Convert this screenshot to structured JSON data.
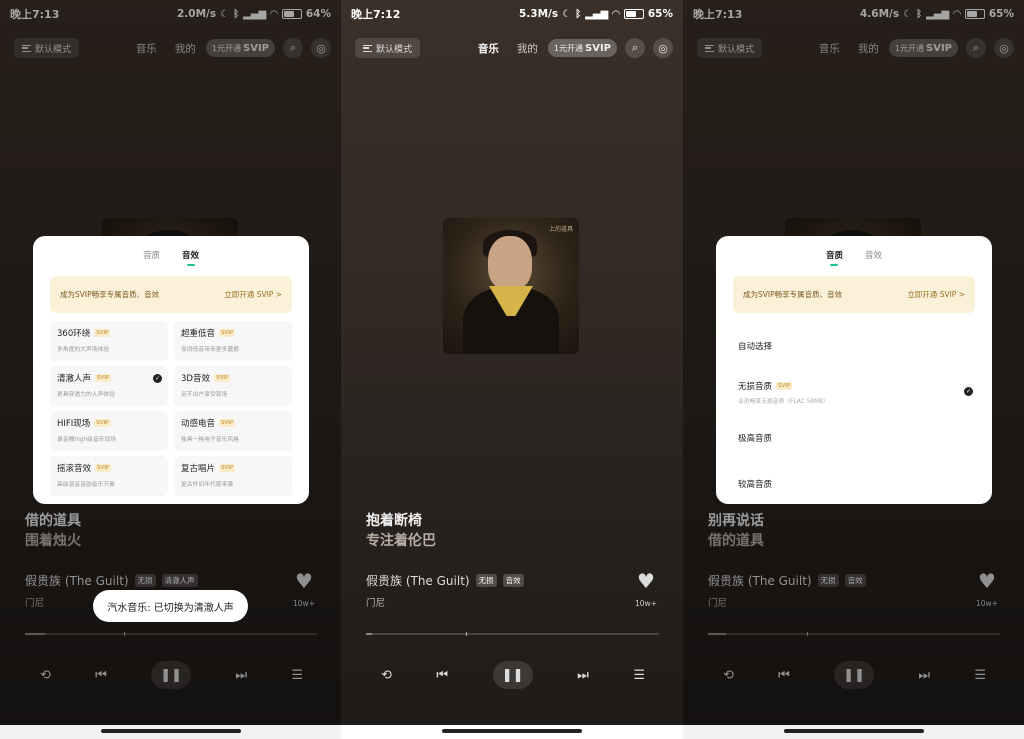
{
  "panels": [
    {
      "status": {
        "time": "晚上7:13",
        "speed": "2.0M/s",
        "battery": "64%",
        "battery_level": 0.64
      },
      "header": {
        "mode": "默认模式",
        "tab_music": "音乐",
        "tab_mine": "我的",
        "svip_small": "1元开通",
        "svip_big": "SVIP"
      },
      "song": {
        "line1": "借的道具",
        "line2": "围着烛火",
        "album": "假贵族 (The Guilt)",
        "tag1": "无损",
        "tag2": "清澈人声",
        "singer": "门尼",
        "likes": "10w+"
      },
      "progress": 0.07,
      "sheet": {
        "tab1": "音质",
        "tab2": "音效",
        "promo": "成为SVIP畅享专属音质、音效",
        "promo_action": "立即开通 SVIP >",
        "effects": [
          {
            "name": "360环绕",
            "badge": "SVIP",
            "desc": "多角度的大声场体验"
          },
          {
            "name": "超重低音",
            "badge": "SVIP",
            "desc": "澎湃低音带来更多震撼"
          },
          {
            "name": "清澈人声",
            "badge": "SVIP",
            "desc": "更具穿透力的人声体验"
          },
          {
            "name": "3D音效",
            "badge": "SVIP",
            "desc": "足不出户享受现场"
          },
          {
            "name": "HIFI现场",
            "badge": "SVIP",
            "desc": "录音棚high级音乐现场"
          },
          {
            "name": "动感电音",
            "badge": "SVIP",
            "desc": "独具一格电子音乐风格"
          },
          {
            "name": "摇滚音效",
            "badge": "SVIP",
            "desc": "高级混音音韵音乐节奏"
          },
          {
            "name": "复古唱片",
            "badge": "SVIP",
            "desc": "复古怀旧年代感来袭"
          }
        ]
      },
      "toast": "汽水音乐: 已切换为清澈人声"
    },
    {
      "status": {
        "time": "晚上7:12",
        "speed": "5.3M/s",
        "battery": "65%",
        "battery_level": 0.65
      },
      "header": {
        "mode": "默认模式",
        "tab_music": "音乐",
        "tab_mine": "我的",
        "svip_small": "1元开通",
        "svip_big": "SVIP"
      },
      "cover_caption": "上的道具",
      "song": {
        "line1": "抱着断椅",
        "line2": "专注着伦巴",
        "album": "假贵族 (The Guilt)",
        "tag1": "无损",
        "tag2": "音效",
        "singer": "门尼",
        "likes": "10w+"
      },
      "progress": 0.02
    },
    {
      "status": {
        "time": "晚上7:13",
        "speed": "4.6M/s",
        "battery": "65%",
        "battery_level": 0.65
      },
      "header": {
        "mode": "默认模式",
        "tab_music": "音乐",
        "tab_mine": "我的",
        "svip_small": "1元开通",
        "svip_big": "SVIP"
      },
      "song": {
        "line1": "别再说话",
        "line2": "借的道具",
        "album": "假贵族 (The Guilt)",
        "tag1": "无损",
        "tag2": "音效",
        "singer": "门尼",
        "likes": "10w+"
      },
      "progress": 0.06,
      "sheet": {
        "tab1": "音质",
        "tab2": "音效",
        "promo": "成为SVIP畅享专属音质、音效",
        "promo_action": "立即开通 SVIP >",
        "qualities": [
          {
            "name": "自动选择",
            "badge": "",
            "desc": ""
          },
          {
            "name": "无损音质",
            "badge": "SVIP",
            "desc": "会员畅享无损音质（FLAC 58MB）"
          },
          {
            "name": "极高音质",
            "badge": "",
            "desc": ""
          },
          {
            "name": "较高音质",
            "badge": "",
            "desc": ""
          }
        ]
      }
    }
  ],
  "icons": {
    "wifi": "wifi-icon",
    "bluetooth": "bluetooth-icon",
    "heart": "heart-icon",
    "play": "pause-icon"
  }
}
